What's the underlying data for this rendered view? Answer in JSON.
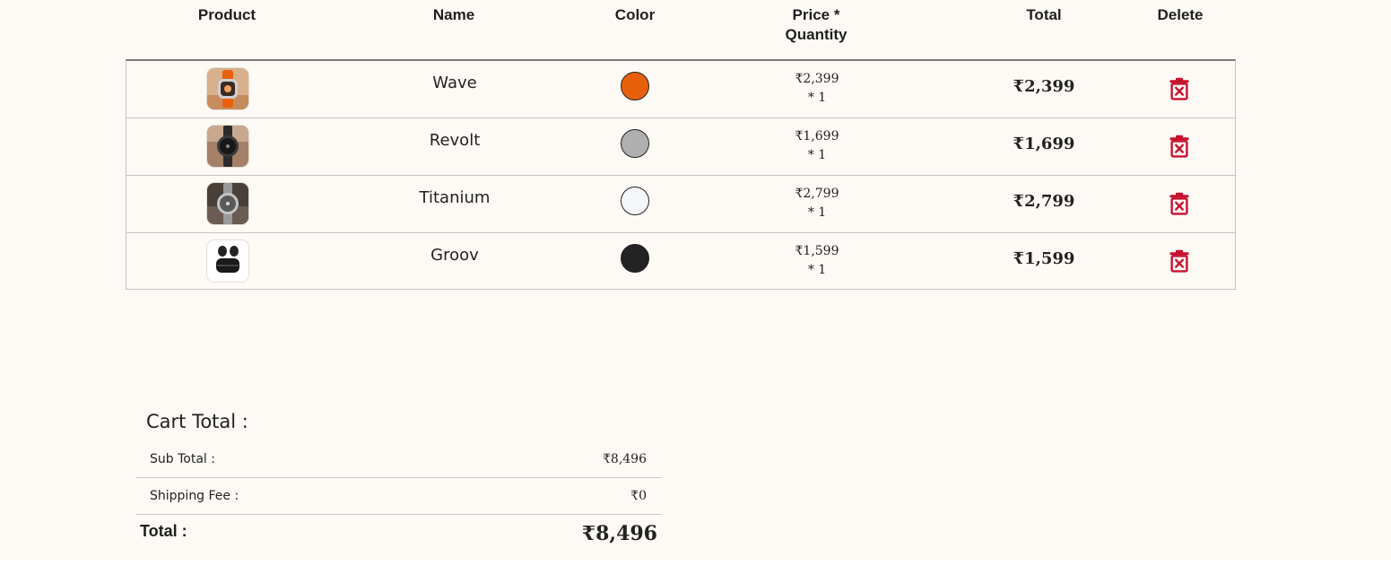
{
  "table": {
    "headers": {
      "product": "Product",
      "name": "Name",
      "color": "Color",
      "price_line1": "Price *",
      "price_line2": "Quantity",
      "total": "Total",
      "delete": "Delete"
    },
    "rows": [
      {
        "product_image": "orange-smartwatch-image",
        "name": "Wave",
        "color": "#e8600c",
        "price": "₹2,399",
        "quantity": "* 1",
        "total": "₹2,399",
        "delete_icon": "trash-icon"
      },
      {
        "product_image": "black-smartwatch-image",
        "name": "Revolt",
        "color": "#b0b0b0",
        "price": "₹1,699",
        "quantity": "* 1",
        "total": "₹1,699",
        "delete_icon": "trash-icon"
      },
      {
        "product_image": "silver-smartwatch-image",
        "name": "Titanium",
        "color": "#f4f6f8",
        "price": "₹2,799",
        "quantity": "* 1",
        "total": "₹2,799",
        "delete_icon": "trash-icon"
      },
      {
        "product_image": "black-earbuds-image",
        "name": "Groov",
        "color": "#232323",
        "price": "₹1,599",
        "quantity": "* 1",
        "total": "₹1,599",
        "delete_icon": "trash-icon"
      }
    ]
  },
  "cart_total": {
    "title": "Cart Total :",
    "subtotal_label": "Sub Total :",
    "subtotal_value": "₹8,496",
    "shipping_label": "Shipping Fee :",
    "shipping_value": "₹0",
    "total_label": "Total :",
    "total_value": "₹8,496"
  },
  "colors": {
    "page_background": "#fdfaf6",
    "delete_icon": "#c8102e"
  }
}
